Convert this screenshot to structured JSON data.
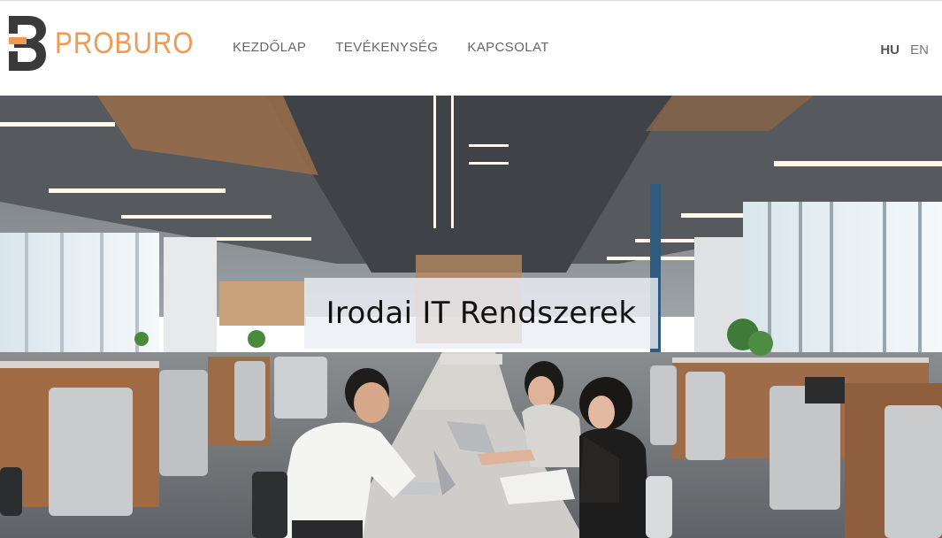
{
  "brand": {
    "name": "PROBURO",
    "accent_color": "#f29a54",
    "mark_color": "#3a3a3a",
    "mark_icon": "proburo-logo-icon"
  },
  "nav": {
    "items": [
      {
        "label": "KEZDŐLAP"
      },
      {
        "label": "TEVÉKENYSÉG"
      },
      {
        "label": "KAPCSOLAT"
      }
    ]
  },
  "languages": {
    "active": "HU",
    "other": "EN"
  },
  "hero": {
    "title": "Irodai IT Rendszerek",
    "image": "open-office-photo"
  }
}
